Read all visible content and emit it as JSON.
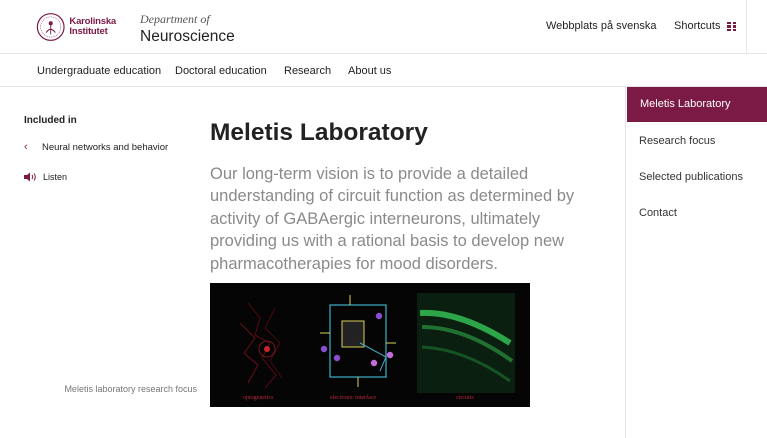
{
  "header": {
    "logo_lines": [
      "Karolinska",
      "Institutet"
    ],
    "department_prefix": "Department of",
    "department_name": "Neuroscience",
    "language_link": "Webbplats på svenska",
    "shortcuts_label": "Shortcuts",
    "shortcuts_icon": "grid-icon"
  },
  "nav": {
    "items": [
      "Undergraduate education",
      "Doctoral education",
      "Research",
      "About us"
    ]
  },
  "sidebar_left": {
    "included_label": "Included in",
    "parent_link": "Neural networks and behavior",
    "listen_label": "Listen"
  },
  "main": {
    "title": "Meletis Laboratory",
    "lead": "Our long-term vision is to provide a detailed understanding of circuit function as determined by activity of GABAergic interneurons, ultimately providing us with a rational basis to develop new pharmacotherapies for mood disorders.",
    "figure_panel_labels": [
      "optogenetics",
      "electronic interface",
      "circuits"
    ],
    "figure_caption": "Meletis laboratory research focus"
  },
  "right_nav": {
    "items": [
      "Meletis Laboratory",
      "Research focus",
      "Selected publications",
      "Contact"
    ],
    "active": "Meletis Laboratory"
  },
  "colors": {
    "brand": "#7b1a45",
    "lead_text": "#8a8a8a"
  }
}
